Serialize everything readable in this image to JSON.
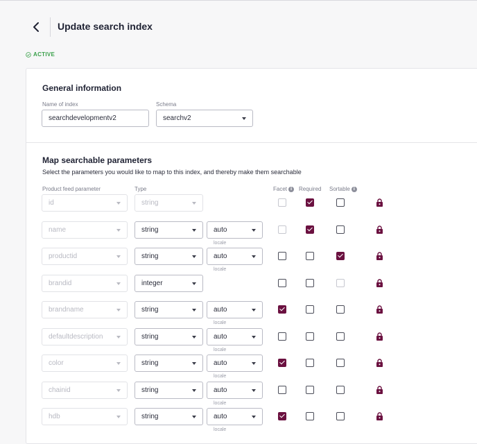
{
  "header": {
    "title": "Update search index",
    "status": "ACTIVE"
  },
  "general": {
    "heading": "General information",
    "name_label": "Name of index",
    "name_value": "searchdevelopmentv2",
    "schema_label": "Schema",
    "schema_value": "searchv2"
  },
  "mapping": {
    "heading": "Map searchable parameters",
    "description": "Select the parameters you would like to map to this index, and thereby make them searchable",
    "columns": {
      "param": "Product feed parameter",
      "type": "Type",
      "facet": "Facet",
      "required": "Required",
      "sortable": "Sortable"
    },
    "locale_label": "locale",
    "rows": [
      {
        "param": "id",
        "type": "string",
        "locale": null,
        "facet": false,
        "required": true,
        "sortable": false,
        "facet_disabled": true,
        "required_disabled": false,
        "sortable_disabled": false,
        "type_disabled": true
      },
      {
        "param": "name",
        "type": "string",
        "locale": "auto",
        "facet": false,
        "required": true,
        "sortable": false,
        "facet_disabled": true,
        "required_disabled": false,
        "sortable_disabled": false,
        "type_disabled": false
      },
      {
        "param": "productid",
        "type": "string",
        "locale": "auto",
        "facet": false,
        "required": false,
        "sortable": true,
        "facet_disabled": false,
        "required_disabled": false,
        "sortable_disabled": false,
        "type_disabled": false
      },
      {
        "param": "brandid",
        "type": "integer",
        "locale": null,
        "facet": false,
        "required": false,
        "sortable": false,
        "facet_disabled": false,
        "required_disabled": false,
        "sortable_disabled": true,
        "type_disabled": false
      },
      {
        "param": "brandname",
        "type": "string",
        "locale": "auto",
        "facet": true,
        "required": false,
        "sortable": false,
        "facet_disabled": false,
        "required_disabled": false,
        "sortable_disabled": false,
        "type_disabled": false
      },
      {
        "param": "defaultdescription",
        "type": "string",
        "locale": "auto",
        "facet": false,
        "required": false,
        "sortable": false,
        "facet_disabled": false,
        "required_disabled": false,
        "sortable_disabled": false,
        "type_disabled": false
      },
      {
        "param": "color",
        "type": "string",
        "locale": "auto",
        "facet": true,
        "required": false,
        "sortable": false,
        "facet_disabled": false,
        "required_disabled": false,
        "sortable_disabled": false,
        "type_disabled": false
      },
      {
        "param": "chainid",
        "type": "string",
        "locale": "auto",
        "facet": false,
        "required": false,
        "sortable": false,
        "facet_disabled": false,
        "required_disabled": false,
        "sortable_disabled": false,
        "type_disabled": false
      },
      {
        "param": "hdb",
        "type": "string",
        "locale": "auto",
        "facet": true,
        "required": false,
        "sortable": false,
        "facet_disabled": false,
        "required_disabled": false,
        "sortable_disabled": false,
        "type_disabled": false
      }
    ]
  },
  "colors": {
    "accent": "#6b1140",
    "status_green": "#3aa04a"
  }
}
